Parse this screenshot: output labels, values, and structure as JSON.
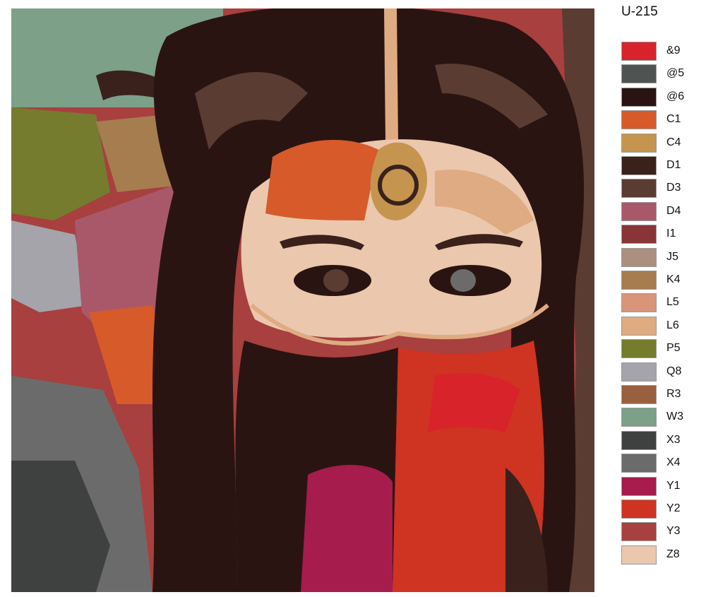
{
  "kit_code": "U-215",
  "artwork": {
    "description_icon": "painted-portrait-veiled-woman"
  },
  "palette": [
    {
      "code": "&9",
      "color": "#d8232b"
    },
    {
      "code": "@5",
      "color": "#4f5452"
    },
    {
      "code": "@6",
      "color": "#2a1412"
    },
    {
      "code": "C1",
      "color": "#d75a2a"
    },
    {
      "code": "C4",
      "color": "#c59550"
    },
    {
      "code": "D1",
      "color": "#3a211b"
    },
    {
      "code": "D3",
      "color": "#5a3c33"
    },
    {
      "code": "D4",
      "color": "#a9586a"
    },
    {
      "code": "I1",
      "color": "#893537"
    },
    {
      "code": "J5",
      "color": "#ad8f7f"
    },
    {
      "code": "K4",
      "color": "#a67d4f"
    },
    {
      "code": "L5",
      "color": "#d9957a"
    },
    {
      "code": "L6",
      "color": "#dfab82"
    },
    {
      "code": "P5",
      "color": "#757c2e"
    },
    {
      "code": "Q8",
      "color": "#a4a4aa"
    },
    {
      "code": "R3",
      "color": "#98603e"
    },
    {
      "code": "W3",
      "color": "#7ca088"
    },
    {
      "code": "X3",
      "color": "#3f4140"
    },
    {
      "code": "X4",
      "color": "#6c6b6b"
    },
    {
      "code": "Y1",
      "color": "#a51c4d"
    },
    {
      "code": "Y2",
      "color": "#cf3322"
    },
    {
      "code": "Y3",
      "color": "#a7403e"
    },
    {
      "code": "Z8",
      "color": "#ebc7ad"
    }
  ]
}
